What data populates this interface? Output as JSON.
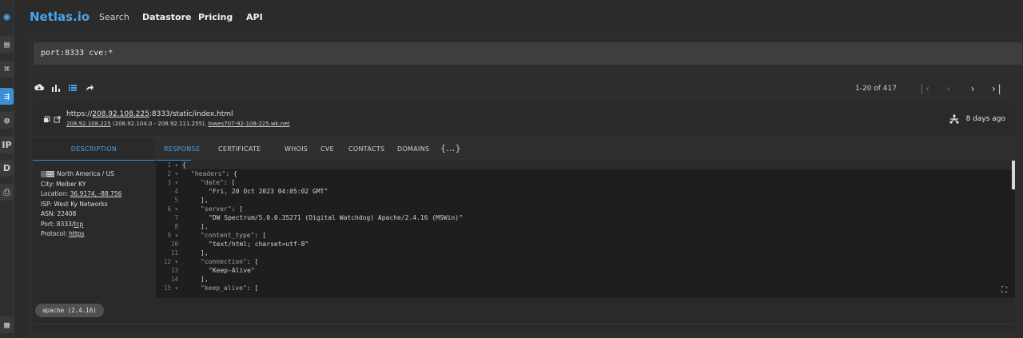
{
  "nav": {
    "brand": "Netlas.io",
    "items": [
      "Search",
      "Datastore",
      "Pricing",
      "API"
    ]
  },
  "rail": {
    "items": [
      "host-icon",
      "network-icon",
      "share-icon",
      "globe-icon",
      "IP",
      "D",
      "print-icon",
      "keyboard-icon"
    ],
    "ip_label": "IP",
    "d_label": "D"
  },
  "query": {
    "value": "port:8333 cve:*"
  },
  "pager": {
    "range": "1-20 of 417",
    "first": "|‹",
    "prev": "‹",
    "next": "›",
    "last": "›|"
  },
  "result": {
    "url_prefix": "https://",
    "url_host": "208.92.108.225",
    "url_rest": ":8333/static/index.html",
    "sub_ip": "208.92.108.225",
    "sub_range": " (208.92.104.0 - 208.92.111.255), ",
    "sub_domain": "lowes707-92-108-225.wk.net",
    "age": "8 days ago",
    "tabs": {
      "description": "DESCRIPTION",
      "response": "RESPONSE",
      "certificate": "CERTIFICATE",
      "whois": "WHOIS",
      "cve": "CVE",
      "contacts": "CONTACTS",
      "domains": "DOMAINS",
      "json": "{…}"
    },
    "info": {
      "region": "North America / US",
      "city": "City: Melber KY",
      "location_label": "Location: ",
      "location_value": "36.9174, -88.756",
      "isp": "ISP: West Ky Networks",
      "asn": "ASN: 22408",
      "port_label": "Port: 8333/",
      "port_proto": "tcp",
      "protocol_label": "Protocol: ",
      "protocol_value": "https"
    },
    "code": {
      "gutter": [
        "1 ▾",
        "2 ▾",
        "3 ▾",
        "4",
        "5",
        "6 ▾",
        "7",
        "8",
        "9 ▾",
        "10",
        "11",
        "12 ▾",
        "13",
        "14",
        "15 ▾"
      ],
      "l1": "{",
      "l2k": "\"headers\"",
      "l2r": ": {",
      "l3k": "\"date\"",
      "l3r": ": [",
      "l4": "\"Fri, 20 Oct 2023 04:05:02 GMT\"",
      "l5": "],",
      "l6k": "\"server\"",
      "l6r": ": [",
      "l7": "\"DW Spectrum/5.0.0.35271 (Digital Watchdog) Apache/2.4.16 (MSWin)\"",
      "l8": "],",
      "l9k": "\"content_type\"",
      "l9r": ": [",
      "l10": "\"text/html; charset=utf-8\"",
      "l11": "],",
      "l12k": "\"connection\"",
      "l12r": ": [",
      "l13": "\"Keep-Alive\"",
      "l14": "],",
      "l15k": "\"keep_alive\"",
      "l15r": ": ["
    },
    "tag": "apache (2.4.16)"
  }
}
